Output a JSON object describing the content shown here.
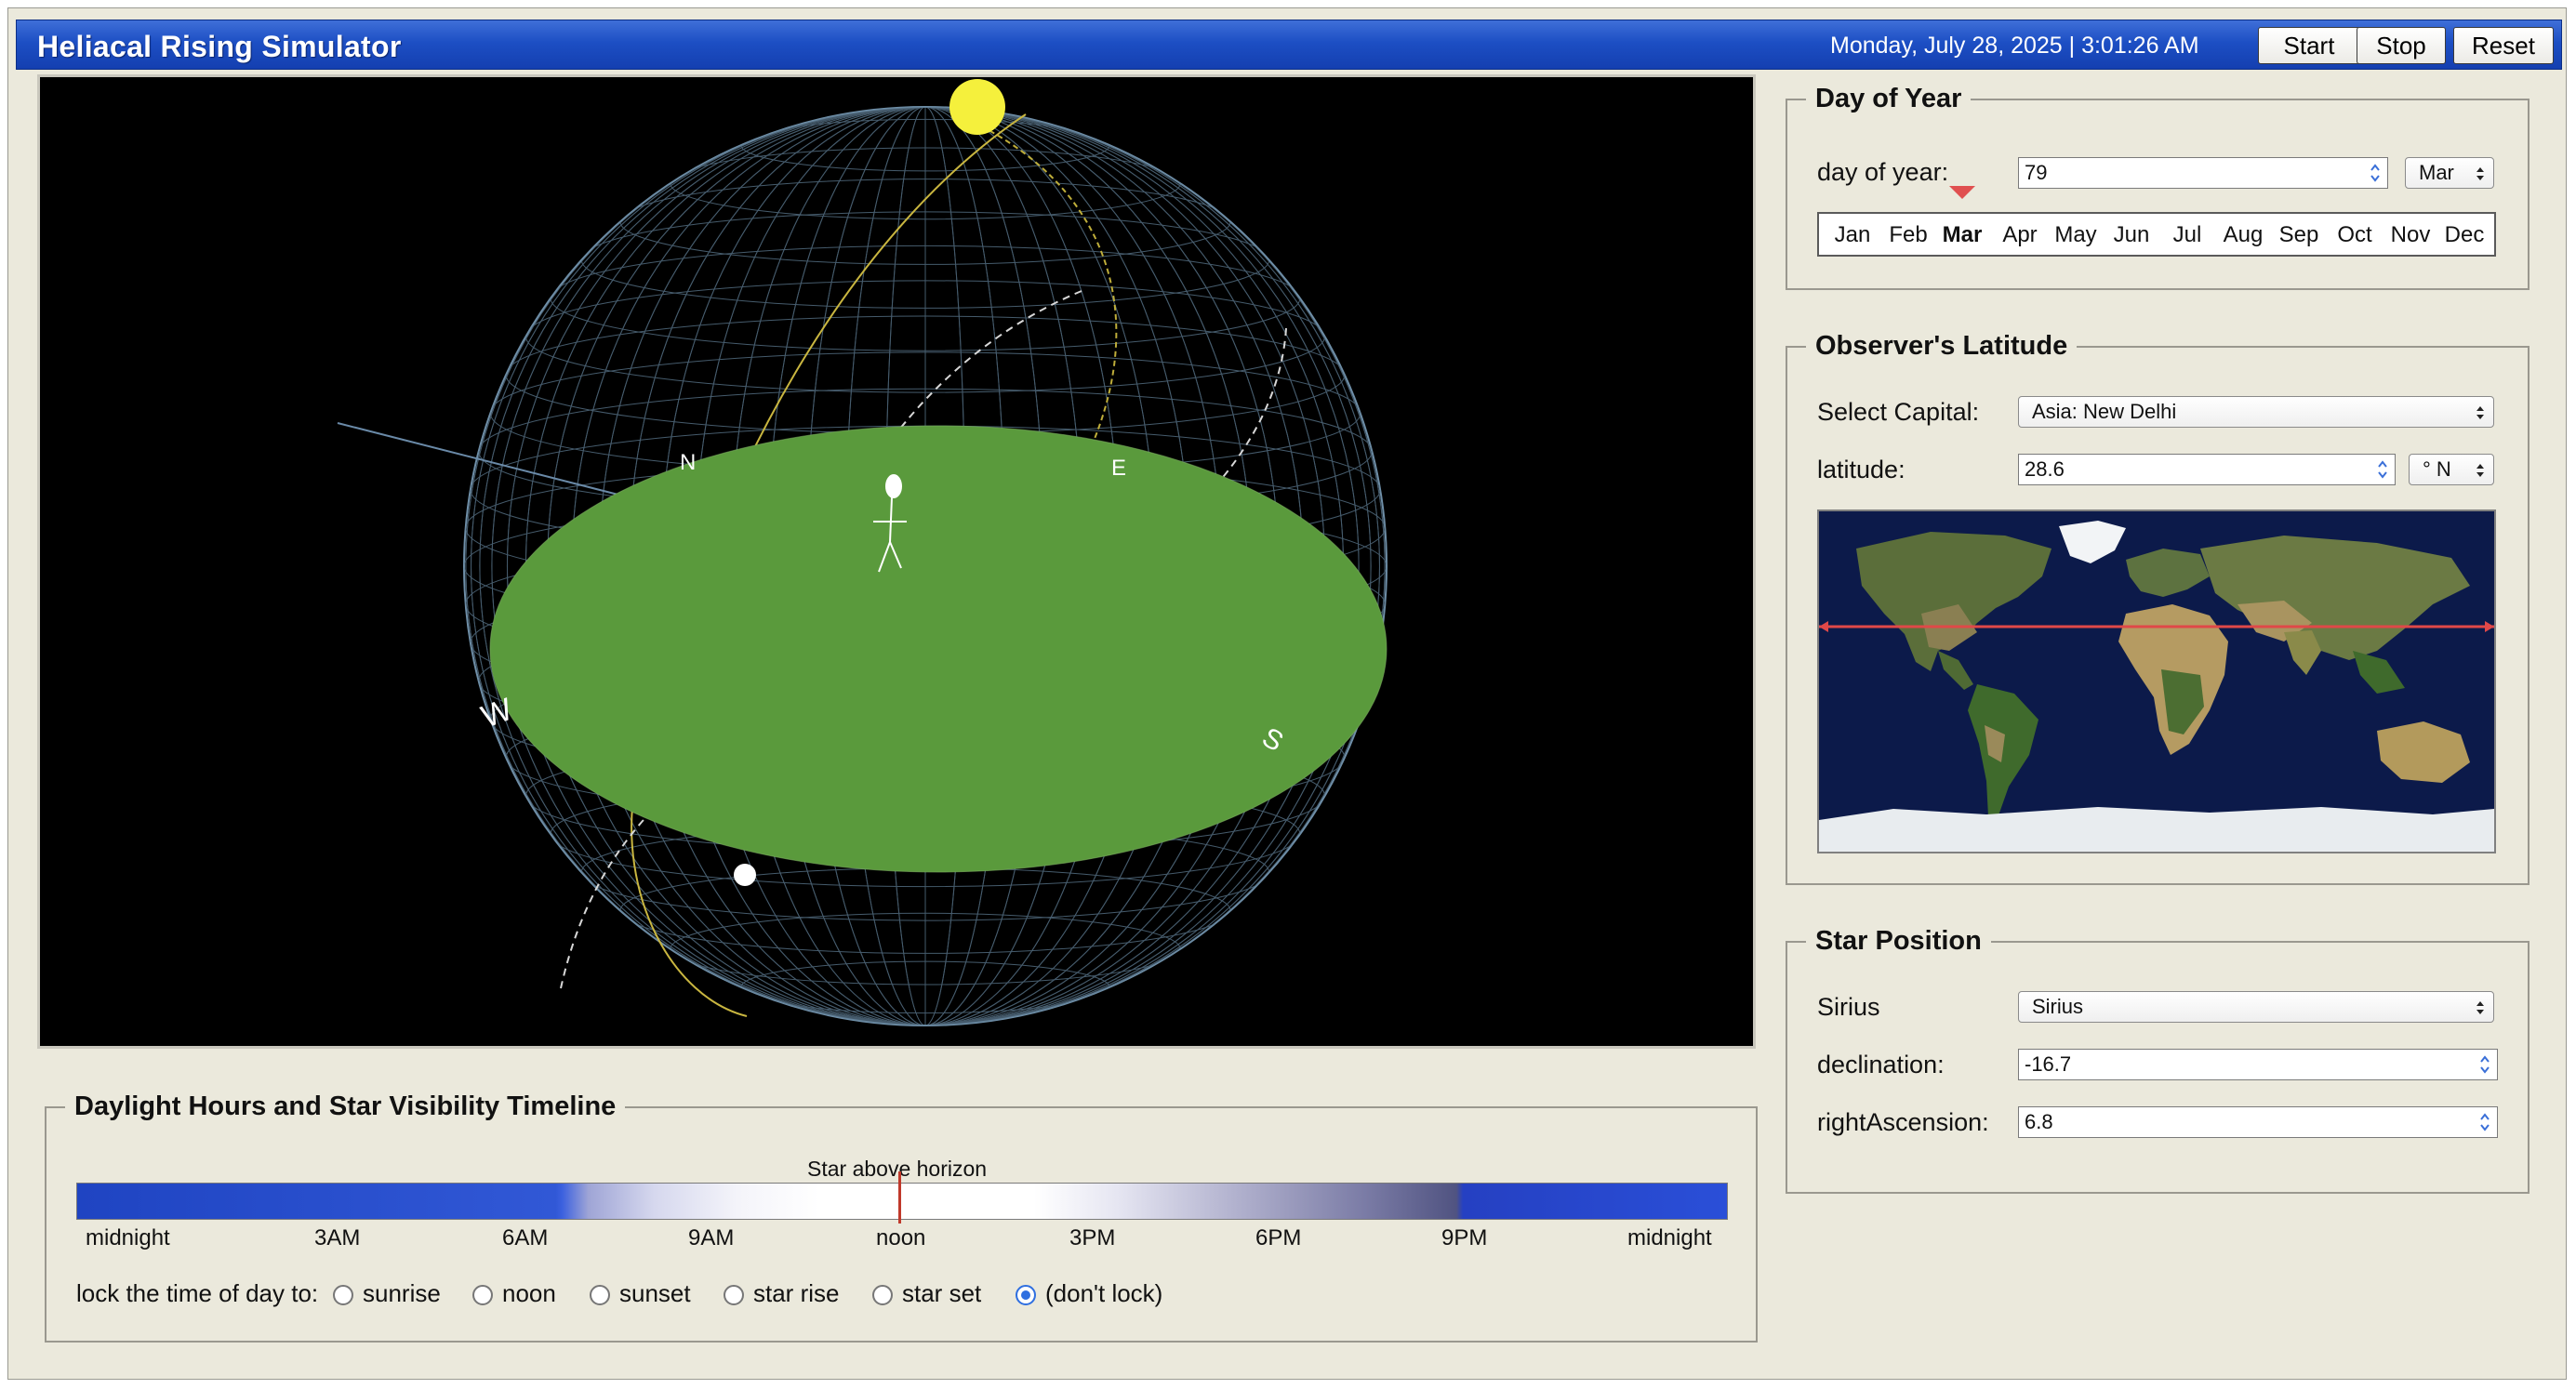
{
  "window": {
    "title": "Heliacal Rising Simulator",
    "datetime": "Monday, July 28, 2025 | 3:01:26 AM",
    "buttons": {
      "start": "Start",
      "stop": "Stop",
      "reset": "Reset"
    }
  },
  "scene": {
    "compass": {
      "north": "N",
      "east": "E",
      "south": "S",
      "west": "W"
    },
    "horizon_color": "#5a9a3c",
    "sun_color": "#f5f03c",
    "star_color": "#ffffff"
  },
  "day_of_year": {
    "legend": "Day of Year",
    "label": "day of year:",
    "value": "79",
    "month_selected": "Mar",
    "months": [
      "Jan",
      "Feb",
      "Mar",
      "Apr",
      "May",
      "Jun",
      "Jul",
      "Aug",
      "Sep",
      "Oct",
      "Nov",
      "Dec"
    ],
    "marker_color": "#e05050"
  },
  "latitude": {
    "legend": "Observer's Latitude",
    "capital_label": "Select Capital:",
    "capital_value": "Asia: New Delhi",
    "latitude_label": "latitude:",
    "latitude_value": "28.6",
    "hemisphere": "° N",
    "line_color": "#e04848"
  },
  "star": {
    "legend": "Star Position",
    "name_label": "Sirius",
    "name_value": "Sirius",
    "declination_label": "declination:",
    "declination_value": "-16.7",
    "ra_label": "rightAscension:",
    "ra_value": "6.8"
  },
  "timeline": {
    "legend": "Daylight Hours and Star Visibility Timeline",
    "star_caption": "Star above horizon",
    "ticks": [
      "midnight",
      "3AM",
      "6AM",
      "9AM",
      "noon",
      "3PM",
      "6PM",
      "9PM",
      "midnight"
    ],
    "lock_label": "lock the time of day to:",
    "options": [
      "sunrise",
      "noon",
      "sunset",
      "star rise",
      "star set",
      "(don't lock)"
    ],
    "selected_option": "(don't lock)",
    "now_marker_color": "#c0392b"
  }
}
